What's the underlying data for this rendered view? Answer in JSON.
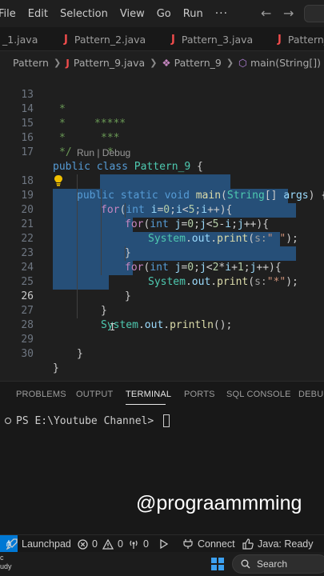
{
  "menu": {
    "items": [
      "File",
      "Edit",
      "Selection",
      "View",
      "Go",
      "Run"
    ],
    "more": "···"
  },
  "tabs": [
    {
      "label": "_1.java"
    },
    {
      "label": "Pattern_2.java"
    },
    {
      "label": "Pattern_3.java"
    },
    {
      "label": "Pattern_"
    }
  ],
  "breadcrumb": {
    "folder": "Pattern",
    "file": "Pattern_9.java",
    "class": "Pattern_9",
    "method": "main(String[])"
  },
  "editor": {
    "line_numbers": [
      "13",
      "14",
      "15",
      "16",
      "17",
      "",
      "18",
      "19",
      "20",
      "21",
      "22",
      "23",
      "24",
      "25",
      "26",
      "27",
      "28",
      "29",
      "30"
    ],
    "codelens": "Run | Debug",
    "code": {
      "l13": {
        "star": "*",
        "stars": "*****"
      },
      "l14": {
        "star": "*",
        "stars": "***"
      },
      "l15": {
        "star": "*",
        "stars": "*"
      },
      "l16": "*/",
      "l17": {
        "kw1": "public",
        "kw2": "class",
        "name": "Pattern_9",
        "brace": "{"
      },
      "l18": {
        "kw1": "public",
        "kw2": "static",
        "kw3": "void",
        "fn": "main",
        "type": "String",
        "arr": "[]",
        "param": "args",
        "brace": "{"
      },
      "l19": {
        "kw": "for",
        "p1": "(",
        "type": "int",
        "var1": "i",
        "eq": "=",
        "num1": "0",
        "semi1": ";",
        "var2": "i",
        "lt": "<",
        "num2": "5",
        "semi2": ";",
        "var3": "i",
        "inc": "++){"
      },
      "l20": {
        "kw": "for",
        "p1": "(",
        "type": "int",
        "var1": "j",
        "eq": "=",
        "num1": "0",
        "semi1": ";",
        "var2": "j",
        "lt": "<",
        "num2": "5",
        "minus": "-",
        "var3": "i",
        "semi2": ";",
        "var4": "j",
        "inc": "++){"
      },
      "l21": {
        "cls": "System",
        "dot1": ".",
        "field": "out",
        "dot2": ".",
        "fn": "print",
        "p1": "(",
        "hint": "s:",
        "str": "\" \"",
        "p2": ");"
      },
      "l22": "}",
      "l23": {
        "kw": "for",
        "p1": "(",
        "type": "int",
        "var1": "j",
        "eq": "=",
        "num1": "0",
        "semi1": ";",
        "var2": "j",
        "lt": "<",
        "num2": "2",
        "mul": "*",
        "var3": "i",
        "plus": "+",
        "num3": "1",
        "semi2": ";",
        "var4": "j",
        "inc": "++){"
      },
      "l24": {
        "cls": "System",
        "dot1": ".",
        "field": "out",
        "dot2": ".",
        "fn": "print",
        "p1": "(",
        "hint": "s:",
        "str": "\"*\"",
        "p2": ");"
      },
      "l25": "}",
      "l26": "}",
      "l27": {
        "cls": "System",
        "dot1": ".",
        "field": "out",
        "dot2": ".",
        "fn": "println",
        "p": "();"
      },
      "l29": "}",
      "l30": "}"
    }
  },
  "panel": {
    "tabs": [
      "PROBLEMS",
      "OUTPUT",
      "TERMINAL",
      "PORTS",
      "SQL CONSOLE",
      "DEBUG"
    ],
    "active_tab": "TERMINAL",
    "prompt": "PS E:\\Youtube Channel> ",
    "watermark": "@prograammming"
  },
  "status": {
    "launchpad": "Launchpad",
    "errors": "0",
    "warnings": "0",
    "ports": "0",
    "connect": "Connect",
    "java": "Java: Ready"
  },
  "taskbar": {
    "weather_line1": "c",
    "weather_line2": "udy",
    "search_placeholder": "Search"
  },
  "colors": {
    "selection": "#264f78",
    "keyword": "#569cd6",
    "control": "#c586c0",
    "type": "#4ec9b0",
    "function": "#dcdcaa",
    "variable": "#9cdcfe",
    "number": "#b5cea8",
    "string": "#ce9178",
    "comment": "#6a9955",
    "status_accent": "#0078d4"
  }
}
